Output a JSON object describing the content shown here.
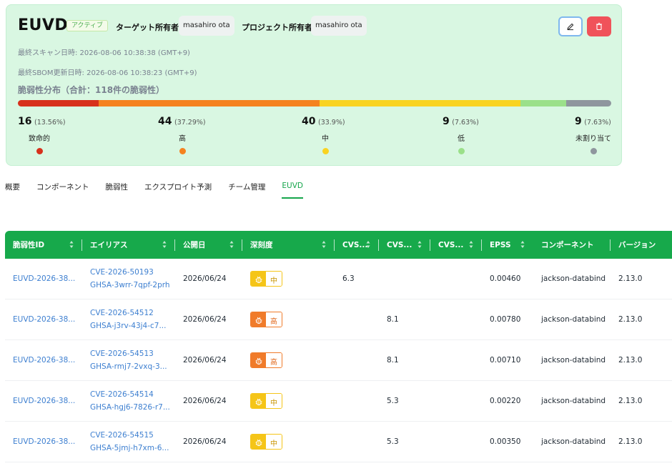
{
  "header": {
    "title": "EUVD",
    "status_badge": "アクティブ",
    "target_owner_label": "ターゲット所有者",
    "target_owner": "masahiro ota",
    "project_owner_label": "プロジェクト所有者",
    "project_owner": "masahiro ota",
    "last_scan": "最終スキャン日時: 2026-08-06 10:38:38 (GMT+9)",
    "last_sbom": "最終SBOM更新日時: 2026-08-06 10:38:23 (GMT+9)",
    "distribution_title": "脆弱性分布（合計：118件の脆弱性）",
    "edit_icon": "pencil-icon",
    "delete_icon": "trash-icon"
  },
  "severity": [
    {
      "count": "16",
      "pct": "(13.56%)",
      "label": "致命的",
      "fraction": 0.1356,
      "color": "#d7311c"
    },
    {
      "count": "44",
      "pct": "(37.29%)",
      "label": "高",
      "fraction": 0.3729,
      "color": "#f5821f"
    },
    {
      "count": "40",
      "pct": "(33.9%)",
      "label": "中",
      "fraction": 0.339,
      "color": "#f9d321"
    },
    {
      "count": "9",
      "pct": "(7.63%)",
      "label": "低",
      "fraction": 0.0763,
      "color": "#9be08a"
    },
    {
      "count": "9",
      "pct": "(7.63%)",
      "label": "未割り当て",
      "fraction": 0.0763,
      "color": "#8f969e"
    }
  ],
  "tabs": [
    "概要",
    "コンポーネント",
    "脆弱性",
    "エクスプロイト予測",
    "チーム管理",
    "EUVD"
  ],
  "table": {
    "headers": [
      "脆弱性ID",
      "エイリアス",
      "公開日",
      "深刻度",
      "CVS...",
      "CVS...",
      "CVS...",
      "EPSS",
      "コンポーネント",
      "バージョン"
    ],
    "rows": [
      {
        "id": "EUVD-2026-38...",
        "alias1": "CVE-2026-50193",
        "alias2": "GHSA-3wrr-7qpf-2prh",
        "date": "2026/06/24",
        "sev": "中",
        "sevclass": "mid",
        "cvss1": "6.3",
        "cvss2": "",
        "cvss3": "",
        "epss": "0.00460",
        "component": "jackson-databind",
        "version": "2.13.0"
      },
      {
        "id": "EUVD-2026-38...",
        "alias1": "CVE-2026-54512",
        "alias2": "GHSA-j3rv-43j4-c7...",
        "date": "2026/06/24",
        "sev": "高",
        "sevclass": "high",
        "cvss1": "",
        "cvss2": "8.1",
        "cvss3": "",
        "epss": "0.00780",
        "component": "jackson-databind",
        "version": "2.13.0"
      },
      {
        "id": "EUVD-2026-38...",
        "alias1": "CVE-2026-54513",
        "alias2": "GHSA-rmj7-2vxq-3...",
        "date": "2026/06/24",
        "sev": "高",
        "sevclass": "high",
        "cvss1": "",
        "cvss2": "8.1",
        "cvss3": "",
        "epss": "0.00710",
        "component": "jackson-databind",
        "version": "2.13.0"
      },
      {
        "id": "EUVD-2026-38...",
        "alias1": "CVE-2026-54514",
        "alias2": "GHSA-hgj6-7826-r7...",
        "date": "2026/06/24",
        "sev": "中",
        "sevclass": "mid",
        "cvss1": "",
        "cvss2": "5.3",
        "cvss3": "",
        "epss": "0.00220",
        "component": "jackson-databind",
        "version": "2.13.0"
      },
      {
        "id": "EUVD-2026-38...",
        "alias1": "CVE-2026-54515",
        "alias2": "GHSA-5jmj-h7xm-6...",
        "date": "2026/06/24",
        "sev": "中",
        "sevclass": "mid",
        "cvss1": "",
        "cvss2": "5.3",
        "cvss3": "",
        "epss": "0.00350",
        "component": "jackson-databind",
        "version": "2.13.0"
      }
    ]
  }
}
